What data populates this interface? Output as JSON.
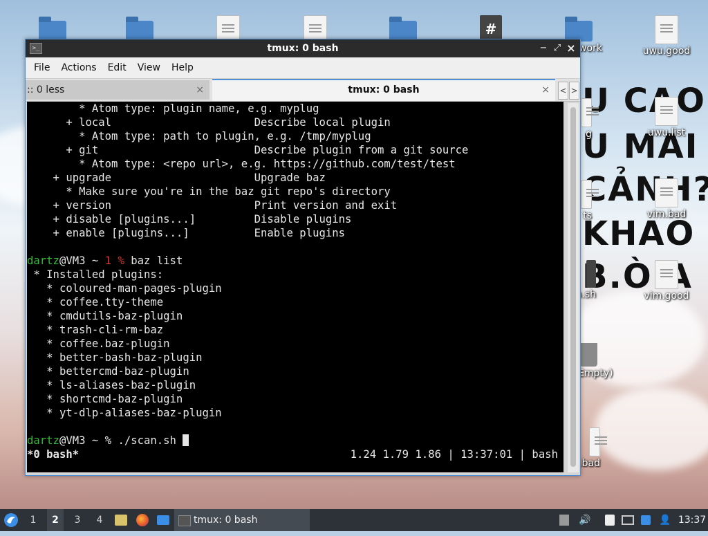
{
  "desktop": {
    "icons": [
      {
        "name": "folder-icon-1",
        "label": ""
      },
      {
        "name": "pictures-folder-icon",
        "label": ""
      },
      {
        "name": "text-file-icon-1",
        "label": ""
      },
      {
        "name": "text-file-icon-2",
        "label": ""
      },
      {
        "name": "home-folder-icon",
        "label": ""
      },
      {
        "name": "script-file-icon-1",
        "label": ""
      },
      {
        "name": "network-icon",
        "label": "work"
      },
      {
        "name": "uwu-good-file-icon",
        "label": "uwu.good"
      },
      {
        "name": "uwu-list-file-icon",
        "label": "uwu.list"
      },
      {
        "name": "vim-bad-file-icon",
        "label": "vim.bad"
      },
      {
        "name": "vim-good-file-icon",
        "label": "vim.good"
      },
      {
        "name": "partial-label-g",
        "label": "g"
      },
      {
        "name": "partial-label-ts",
        "label": "ts"
      },
      {
        "name": "partial-label-sh",
        "label": "n.sh"
      },
      {
        "name": "trash-icon",
        "label": "Empty)"
      },
      {
        "name": "partial-label-bad",
        "label": ".bad"
      }
    ],
    "wallpaper_text": [
      "U CAO",
      "U MAI",
      "CẢNH?",
      "KHAO",
      "B.Ò.A"
    ]
  },
  "window": {
    "title": "tmux: 0 bash",
    "controls": {
      "minimize": "−",
      "maximize": "⤢",
      "close": "×"
    },
    "menu": [
      "File",
      "Actions",
      "Edit",
      "View",
      "Help"
    ],
    "tabs": [
      {
        "label": ":: 0 less",
        "close": "×",
        "active": false
      },
      {
        "label": "tmux: 0 bash",
        "close": "×",
        "active": true
      }
    ],
    "tab_nav": {
      "left": "<",
      "right": ">"
    }
  },
  "terminal": {
    "lines": [
      "        * Atom type: plugin name, e.g. myplug",
      "      + local                      Describe local plugin",
      "        * Atom type: path to plugin, e.g. /tmp/myplug",
      "      + git                        Describe plugin from a git source",
      "        * Atom type: <repo url>, e.g. https://github.com/test/test",
      "    + upgrade                      Upgrade baz",
      "      * Make sure you're in the baz git repo's directory",
      "    + version                      Print version and exit",
      "    + disable [plugins...]         Disable plugins",
      "    + enable [plugins...]          Enable plugins",
      ""
    ],
    "prompt1": {
      "user": "dartz",
      "host": "@VM3 ~ ",
      "status": "1 %",
      "command": " baz list"
    },
    "list_header": " * Installed plugins:",
    "plugins": [
      "   * coloured-man-pages-plugin",
      "   * coffee.tty-theme",
      "   * cmdutils-baz-plugin",
      "   * trash-cli-rm-baz",
      "   * coffee.baz-plugin",
      "   * better-bash-baz-plugin",
      "   * bettercmd-baz-plugin",
      "   * ls-aliases-baz-plugin",
      "   * shortcmd-baz-plugin",
      "   * yt-dlp-aliases-baz-plugin"
    ],
    "blank": "",
    "prompt2": {
      "user": "dartz",
      "host": "@VM3 ~ % ",
      "command": "./scan.sh "
    },
    "status_left": " *0 bash*",
    "status_right": "1.24 1.79 1.86 | 13:37:01 | bash "
  },
  "taskbar": {
    "workspaces": [
      "1",
      "2",
      "3",
      "4"
    ],
    "active_workspace": "2",
    "task_label": "tmux: 0 bash",
    "clock": "13:37"
  }
}
